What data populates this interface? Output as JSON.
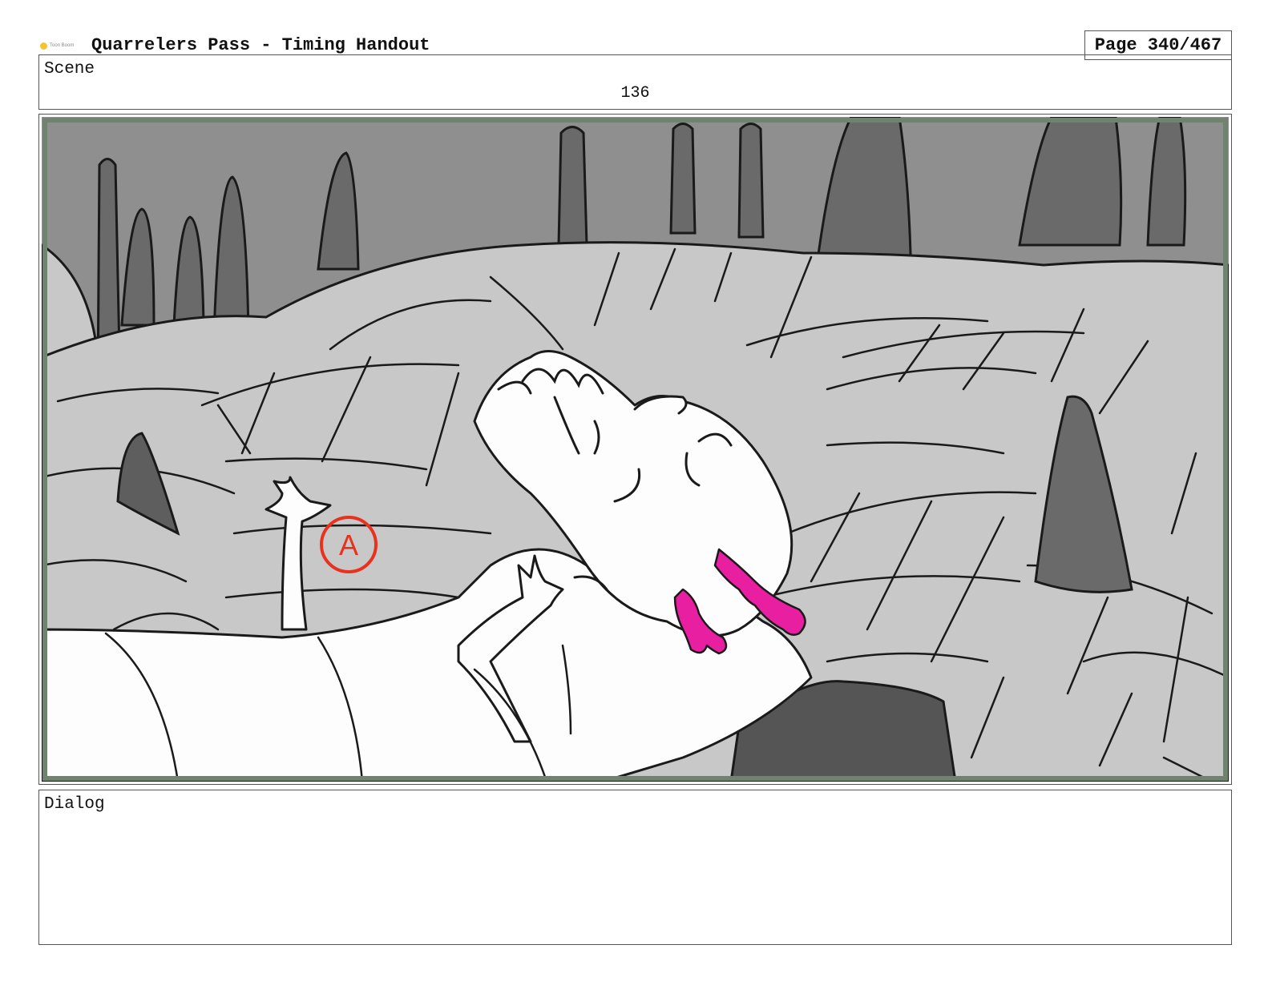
{
  "header": {
    "logo_icon": "toon-boom-logo-icon",
    "title": "Quarrelers Pass - Timing Handout",
    "page_label": "Page 340/467"
  },
  "scene": {
    "label": "Scene",
    "number": "136"
  },
  "panel": {
    "annotation_label": "A",
    "colors": {
      "sky": "#8f8f8f",
      "ground": "#c8c8c8",
      "rock": "#5e5e5e",
      "creature": "#fdfdfd",
      "tongue": "#e81fa0",
      "annotation": "#e8321e",
      "frame": "#6f836f"
    }
  },
  "dialog": {
    "label": "Dialog"
  }
}
